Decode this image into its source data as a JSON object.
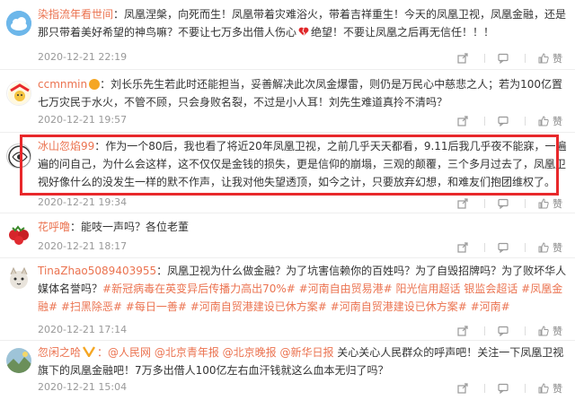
{
  "comments": [
    {
      "username": "染指流年看世间",
      "text": "：凤凰涅槃，向死而生！凤凰带着灾难浴火，带着吉祥重生！今天的凤凰卫视，凤凰金融，还是那只带着美好希望的神鸟嘛？不要让七万多出借人伤心",
      "text_tail": "绝望！不要让凤凰之后再无信任！！！",
      "time": "2020-12-21 22:19"
    },
    {
      "username": "ccmnmin",
      "text": "：刘长乐先生若此时还能担当，妥善解决此次凤金爆雷，则仍是万民心中慈悲之人；若为100亿置七万灾民于水火，不管不顾，只会身败名裂，不过是小人耳！刘先生难道真拎不清吗？",
      "time": "2020-12-21 19:57"
    },
    {
      "username": "冰山忽焰99",
      "text": "：作为一个80后，我也看了将近20年凤凰卫视，之前几乎天天都看，9.11后我几乎夜不能寐，一遍遍的问自己，为什么会这样，这不仅仅是金钱的损失，更是信仰的崩塌，三观的颠覆，三个多月过去了，凤凰卫视好像什么的没发生一样的默不作声，让我对他失望透顶，如今之计，只要放弃幻想，和难友们抱团维权了。",
      "time": "2020-12-21 19:34"
    },
    {
      "username": "花呼噜",
      "text": "：能吱一声吗？各位老董",
      "time": "2020-12-21 18:17"
    },
    {
      "username": "TinaZhao5089403955",
      "text": "：凤凰卫视为什么做金融？为了坑害信赖你的百姓吗？为了自毁招牌吗？为了败坏华人媒体名誉吗？",
      "tags": "#新冠病毒在英变异后传播力高出70%# #河南自由贸易港# 阳光信用超话 银监会超话 #凤凰金融# #扫黑除恶# #每日一善# #河南自贸港建设已休方案# #河南自贸港建设已休方案# #河南#",
      "time": "2020-12-21 17:14"
    },
    {
      "username": "忽闲之哈",
      "mentions": "：@人民网 @北京青年报 @北京晚报 @新华日报",
      "text": " 关心关心人民群众的呼声吧！关注一下凤凰卫视旗下的凤凰金融吧！7万多出借人100亿左右血汗钱就这么血本无归了吗？",
      "time": "2020-12-21 15:04"
    }
  ],
  "actions": {
    "share": "",
    "reply": "",
    "like": "赞"
  }
}
